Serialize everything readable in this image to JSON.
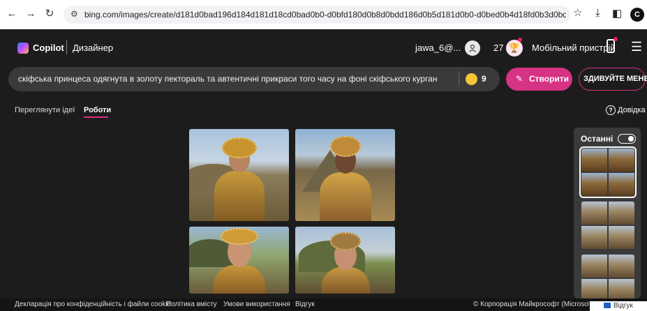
{
  "browser": {
    "url": "bing.com/images/create/d181d0bad196d184d181d18cd0bad0b0-d0bfd180d0b8d0bdd186d0b5d181d0b0-d0bed0b4d18fd0b3d0bdd183d182d0b0-d0b2-d0b7d0..."
  },
  "header": {
    "brand": "Copilot",
    "product": "Дизайнер",
    "user": "jawa_6@...",
    "coins": "27",
    "mobile_label": "Мобільний пристрій"
  },
  "prompt": {
    "text": "скіфська принцеса одягнута в золоту пектораль та автентичні прикраси того часу на фоні скіфського кургану",
    "boosts": "9"
  },
  "buttons": {
    "create": "Створити",
    "surprise": "ЗДИВУЙТЕ МЕНЕ"
  },
  "tabs": {
    "ideas": "Переглянути ідеї",
    "works": "Роботи",
    "help": "Довідка"
  },
  "recent": {
    "label": "Останні"
  },
  "footer": {
    "privacy": "Декларація про конфіденційність і файли cookie",
    "content_policy": "Політика вмісту",
    "terms": "Умови використання",
    "feedback_link": "Відгук",
    "copyright": "© Корпорація Майкрософт (Microsoft C",
    "feedback_button": "Відгук"
  }
}
